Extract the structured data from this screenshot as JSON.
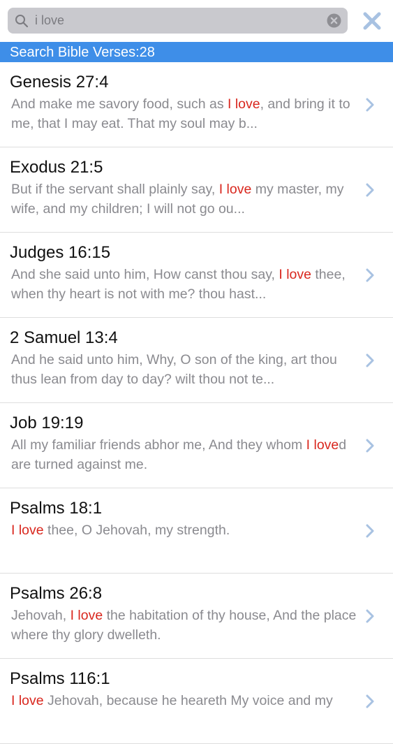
{
  "search": {
    "query": "i love"
  },
  "header": {
    "count_label": "Search Bible Verses:28"
  },
  "colors": {
    "accent": "#3e8ee8",
    "highlight": "#d9271e",
    "verse_text": "#8a8a8f",
    "close": "#a8c2e2"
  },
  "results": [
    {
      "ref": "Genesis 27:4",
      "pre": "And make me savory food, such as ",
      "hl": "I love",
      "post": ", and bring it to me, that I may eat. That my soul may b..."
    },
    {
      "ref": "Exodus 21:5",
      "pre": "But if the servant shall plainly say, ",
      "hl": "I love",
      "post": " my master, my wife, and my children; I will not go ou..."
    },
    {
      "ref": "Judges 16:15",
      "pre": "And she said unto him, How canst thou say, ",
      "hl": "I love",
      "post": " thee, when thy heart is not with me? thou hast..."
    },
    {
      "ref": "2 Samuel 13:4",
      "pre": "And he said unto him, Why, O son of the king, art thou thus lean from day to day? wilt thou not te...",
      "hl": "",
      "post": ""
    },
    {
      "ref": "Job 19:19",
      "pre": "All my familiar friends abhor me, And they whom ",
      "hl": "I love",
      "post": "d are turned against me."
    },
    {
      "ref": "Psalms 18:1",
      "pre": "",
      "hl": "I love",
      "post": " thee, O Jehovah, my strength."
    },
    {
      "ref": "Psalms 26:8",
      "pre": "Jehovah, ",
      "hl": "I love",
      "post": " the habitation of thy house, And the place where thy glory dwelleth."
    },
    {
      "ref": "Psalms 116:1",
      "pre": "",
      "hl": "I love",
      "post": " Jehovah, because he heareth My voice and my"
    }
  ]
}
